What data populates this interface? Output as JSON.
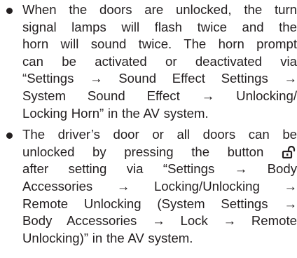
{
  "bullets": [
    {
      "lines": [
        "When the doors are unlocked, the turn",
        "signal lamps will flash twice and the",
        "horn will sound twice. The horn prompt",
        "can be activated or deactivated via",
        "“Settings → Sound Effect Settings →",
        "System Sound Effect → Unlocking/",
        "Locking Horn” in the AV system."
      ]
    },
    {
      "line1": "The driver’s door or all doors can be",
      "line2_before_icon": "unlocked by pressing the button",
      "icon_name": "unlock-padlock-icon",
      "lines_rest": [
        "after setting via “Settings → Body",
        "Accessories → Locking/Unlocking →",
        "Remote Unlocking (System Settings →",
        "Body Accessories → Lock → Remote",
        "Unlocking)” in the AV system."
      ]
    }
  ]
}
